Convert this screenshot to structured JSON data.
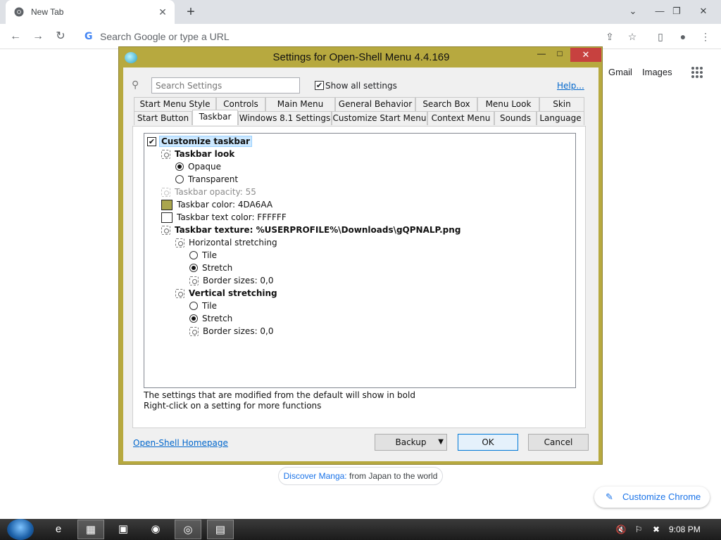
{
  "browser": {
    "tab_title": "New Tab",
    "tab_close": "✕",
    "new_tab": "+",
    "omnibox_placeholder": "Search Google or type a URL",
    "omnibox_g": "G",
    "nav": {
      "back": "←",
      "forward": "→",
      "reload": "↻"
    },
    "toolbar_icons": {
      "share": "⇪",
      "star": "☆",
      "sidepanel": "▯",
      "profile": "●",
      "menu": "⋮"
    },
    "window": {
      "chevron": "⌄",
      "minimize": "—",
      "restore": "❐",
      "close": "✕"
    },
    "ntp": {
      "gmail": "Gmail",
      "images": "Images",
      "discover_accent": "Discover Manga:",
      "discover_text": " from Japan to the world",
      "customize_label": "Customize Chrome",
      "customize_icon": "✎"
    }
  },
  "dialog": {
    "title": "Settings for Open-Shell Menu 4.4.169",
    "min": "—",
    "max": "□",
    "close": "✕",
    "search_placeholder": "Search Settings",
    "search_icon": "⚲",
    "show_all_label": "Show all settings",
    "show_all_checked": "✔",
    "help_link": "Help...",
    "tabs_row1": [
      "Start Menu Style",
      "Controls",
      "Main Menu",
      "General Behavior",
      "Search Box",
      "Menu Look",
      "Skin"
    ],
    "tabs_row2": [
      "Start Button",
      "Taskbar",
      "Windows 8.1 Settings",
      "Customize Start Menu",
      "Context Menu",
      "Sounds",
      "Language"
    ],
    "active_tab": "Taskbar",
    "tree": [
      {
        "label": "Customize taskbar",
        "kind": "check",
        "checked": "✔",
        "style": "bold selected"
      },
      {
        "label": "Taskbar look",
        "kind": "gear",
        "style": "bold"
      },
      {
        "label": "Opaque",
        "kind": "radio-on",
        "style": ""
      },
      {
        "label": "Transparent",
        "kind": "radio-off",
        "style": ""
      },
      {
        "label": "Taskbar opacity: 55",
        "kind": "gear-faint",
        "style": "gray"
      },
      {
        "label": "Taskbar color: 4DA6AA",
        "kind": "swatch",
        "color": "#aaa64d",
        "style": ""
      },
      {
        "label": "Taskbar text color: FFFFFF",
        "kind": "swatch",
        "color": "#ffffff",
        "style": ""
      },
      {
        "label": "Taskbar texture: %USERPROFILE%\\Downloads\\gQPNALP.png",
        "kind": "gear",
        "style": "bold"
      },
      {
        "label": "Horizontal stretching",
        "kind": "gear",
        "style": ""
      },
      {
        "label": "Tile",
        "kind": "radio-off",
        "style": ""
      },
      {
        "label": "Stretch",
        "kind": "radio-on",
        "style": ""
      },
      {
        "label": "Border sizes: 0,0",
        "kind": "gear",
        "style": ""
      },
      {
        "label": "Vertical stretching",
        "kind": "gear",
        "style": "bold"
      },
      {
        "label": "Tile",
        "kind": "radio-off",
        "style": ""
      },
      {
        "label": "Stretch",
        "kind": "radio-on",
        "style": ""
      },
      {
        "label": "Border sizes: 0,0",
        "kind": "gear",
        "style": ""
      }
    ],
    "note1": "The settings that are modified from the default will show in bold",
    "note2": "Right-click on a setting for more functions",
    "homepage_link": "Open-Shell Homepage",
    "backup_label": "Backup",
    "backup_drop": "▼",
    "ok_label": "OK",
    "cancel_label": "Cancel"
  },
  "taskbar": {
    "apps": [
      "e",
      "▦",
      "▣",
      "◉",
      "◎",
      "▤"
    ],
    "tray": [
      "🔇",
      "⚐",
      "✖"
    ],
    "clock": "9:08 PM"
  },
  "colors": {
    "dialog_frame": "#b7a93f",
    "close_red": "#c7413f",
    "link_blue": "#0066cc",
    "chrome_blue": "#1a73e8"
  }
}
